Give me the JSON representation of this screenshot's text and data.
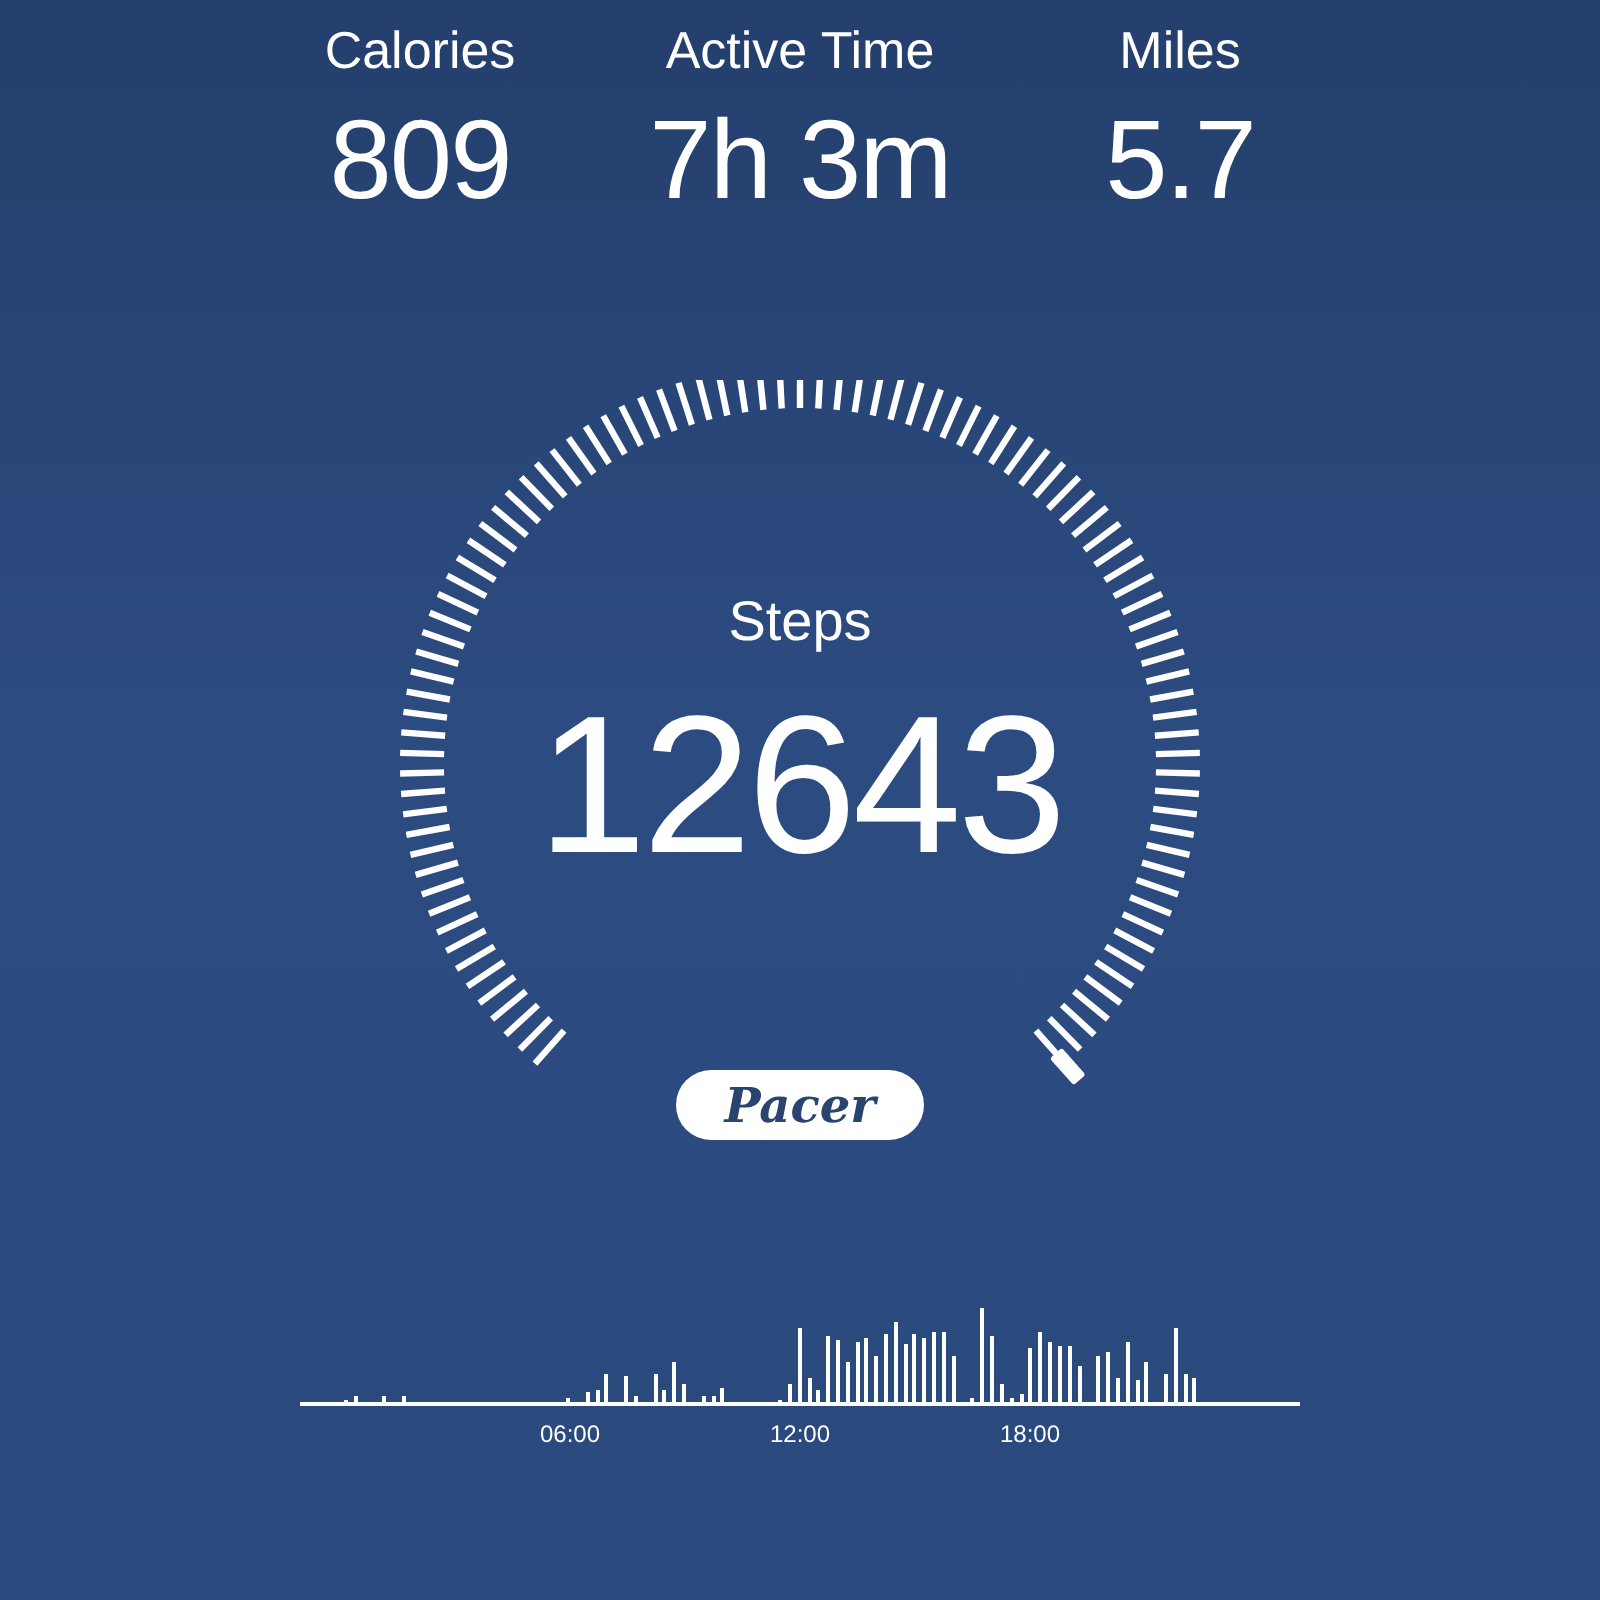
{
  "stats": [
    {
      "label": "Calories",
      "value": "809"
    },
    {
      "label": "Active Time",
      "value": "7h 3m"
    },
    {
      "label": "Miles",
      "value": "5.7"
    }
  ],
  "steps": {
    "label": "Steps",
    "value": "12643"
  },
  "logo": "Pacer",
  "activity_chart": {
    "x_labels": [
      "06:00",
      "12:00",
      "18:00"
    ]
  }
}
